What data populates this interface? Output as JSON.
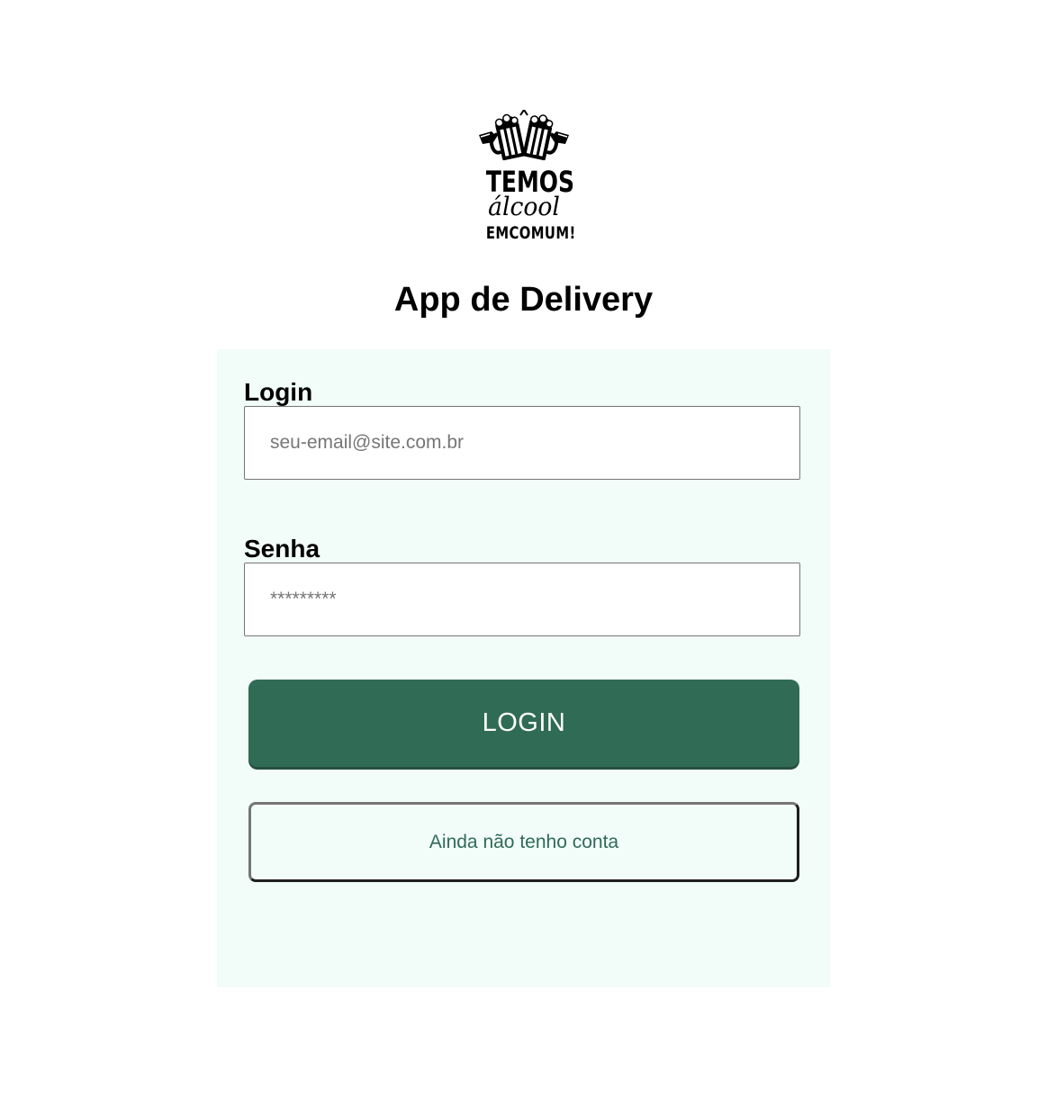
{
  "logo": {
    "line1": "TEMOS",
    "line2": "álcool",
    "line3": "EMCOMUM!",
    "icon": "beer-toast-icon"
  },
  "page_title": "App de Delivery",
  "login_field": {
    "label": "Login",
    "value": "",
    "placeholder": "seu-email@site.com.br"
  },
  "password_field": {
    "label": "Senha",
    "value": "",
    "placeholder": "*********"
  },
  "buttons": {
    "login_label": "LOGIN",
    "register_label": "Ainda não tenho conta"
  },
  "colors": {
    "primary": "#306b56",
    "card_background": "#f2fcf9",
    "input_border": "#767676"
  }
}
